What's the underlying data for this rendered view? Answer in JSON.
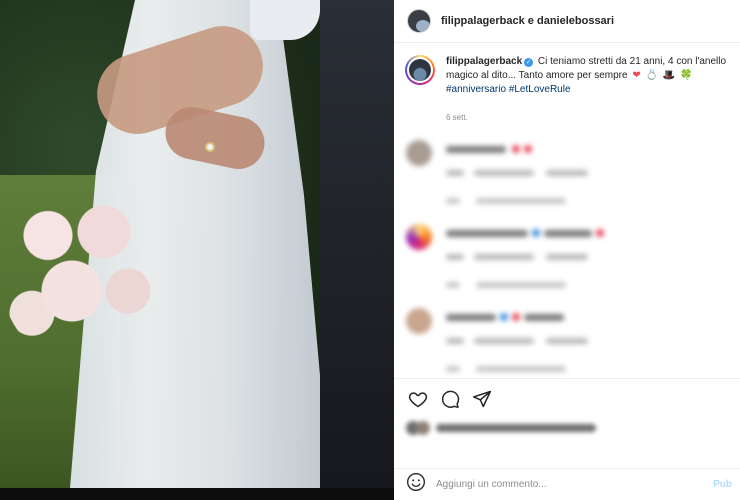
{
  "header": {
    "title": "filippalagerback e danielebossari"
  },
  "caption": {
    "username": "filippalagerback",
    "text": "Ci teniamo stretti da 21 anni, 4 con l'anello magico al dito... Tanto amore per sempre",
    "emojis": [
      "❤",
      "💍",
      "🎩",
      "🍀"
    ],
    "hashtags": "#anniversario #LetLoveRule",
    "time": "6 sett."
  },
  "actions": {
    "like_icon": "heart-outline-icon",
    "comment_icon": "comment-bubble-icon",
    "share_icon": "paper-plane-icon"
  },
  "comment_box": {
    "placeholder": "Aggiungi un commento...",
    "publish_label": "Pub"
  },
  "colors": {
    "accent_blue": "#3897f0",
    "hashtag": "#00376b",
    "heart_red": "#ed4956",
    "muted": "#8e8e8e"
  }
}
